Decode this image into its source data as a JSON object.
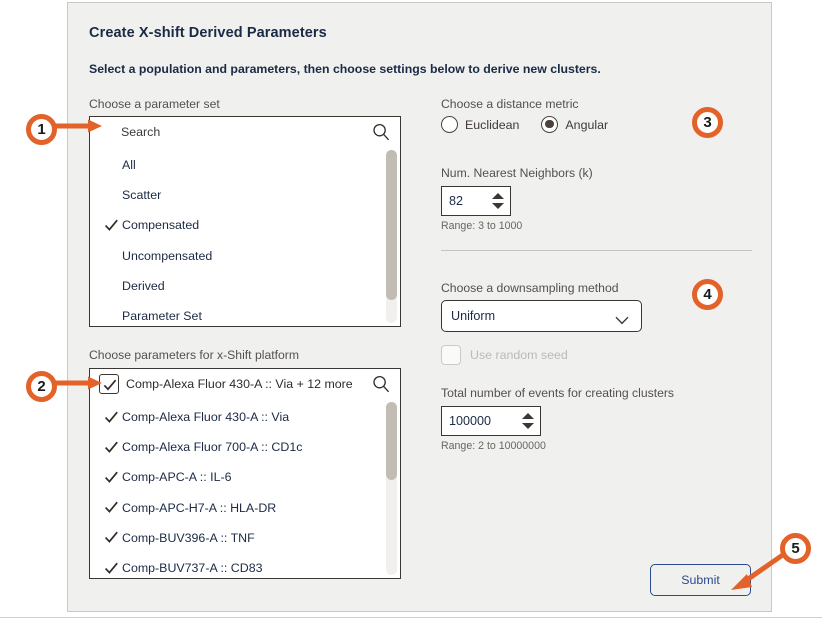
{
  "dialog": {
    "title": "Create X-shift Derived Parameters",
    "subtitle": "Select a population and parameters, then choose settings below to derive new clusters."
  },
  "left": {
    "parameter_set_label": "Choose a parameter set",
    "search_placeholder": "Search",
    "search_icon": "search-icon",
    "parameter_set_options": [
      {
        "label": "All",
        "checked": false
      },
      {
        "label": "Scatter",
        "checked": false
      },
      {
        "label": "Compensated",
        "checked": true
      },
      {
        "label": "Uncompensated",
        "checked": false
      },
      {
        "label": "Derived",
        "checked": false
      },
      {
        "label": "Parameter Set",
        "checked": false
      }
    ],
    "params_label": "Choose parameters for x-Shift platform",
    "params_value": "Comp-Alexa Fluor 430-A :: Via + 12 more",
    "params_checkbox_checked": true,
    "params_options": [
      {
        "label": "Comp-Alexa Fluor 430-A :: Via",
        "checked": true
      },
      {
        "label": "Comp-Alexa Fluor 700-A :: CD1c",
        "checked": true
      },
      {
        "label": "Comp-APC-A :: IL-6",
        "checked": true
      },
      {
        "label": "Comp-APC-H7-A :: HLA-DR",
        "checked": true
      },
      {
        "label": "Comp-BUV396-A :: TNF",
        "checked": true
      },
      {
        "label": "Comp-BUV737-A :: CD83",
        "checked": true
      }
    ]
  },
  "right": {
    "distance_label": "Choose a distance metric",
    "distance_options": [
      {
        "label": "Euclidean",
        "selected": false
      },
      {
        "label": "Angular",
        "selected": true
      }
    ],
    "knn_label": "Num. Nearest Neighbors (k)",
    "knn_value": "82",
    "knn_range": "Range: 3 to 1000",
    "downsample_label": "Choose a downsampling method",
    "downsample_value": "Uniform",
    "downsample_icon": "chevron-down-icon",
    "random_seed_label": "Use random seed",
    "random_seed_checked": false,
    "random_seed_disabled": true,
    "events_label": "Total number of events for creating clusters",
    "events_value": "100000",
    "events_range": "Range: 2 to 10000000"
  },
  "actions": {
    "submit_label": "Submit"
  },
  "callouts": [
    {
      "number": "1"
    },
    {
      "number": "2"
    },
    {
      "number": "3"
    },
    {
      "number": "4"
    },
    {
      "number": "5"
    }
  ],
  "colors": {
    "callout_orange": "#e2622a",
    "submit_blue": "#2b4b8f",
    "panel_bg": "#f0f0ef",
    "heading_navy": "#1b2a44"
  }
}
